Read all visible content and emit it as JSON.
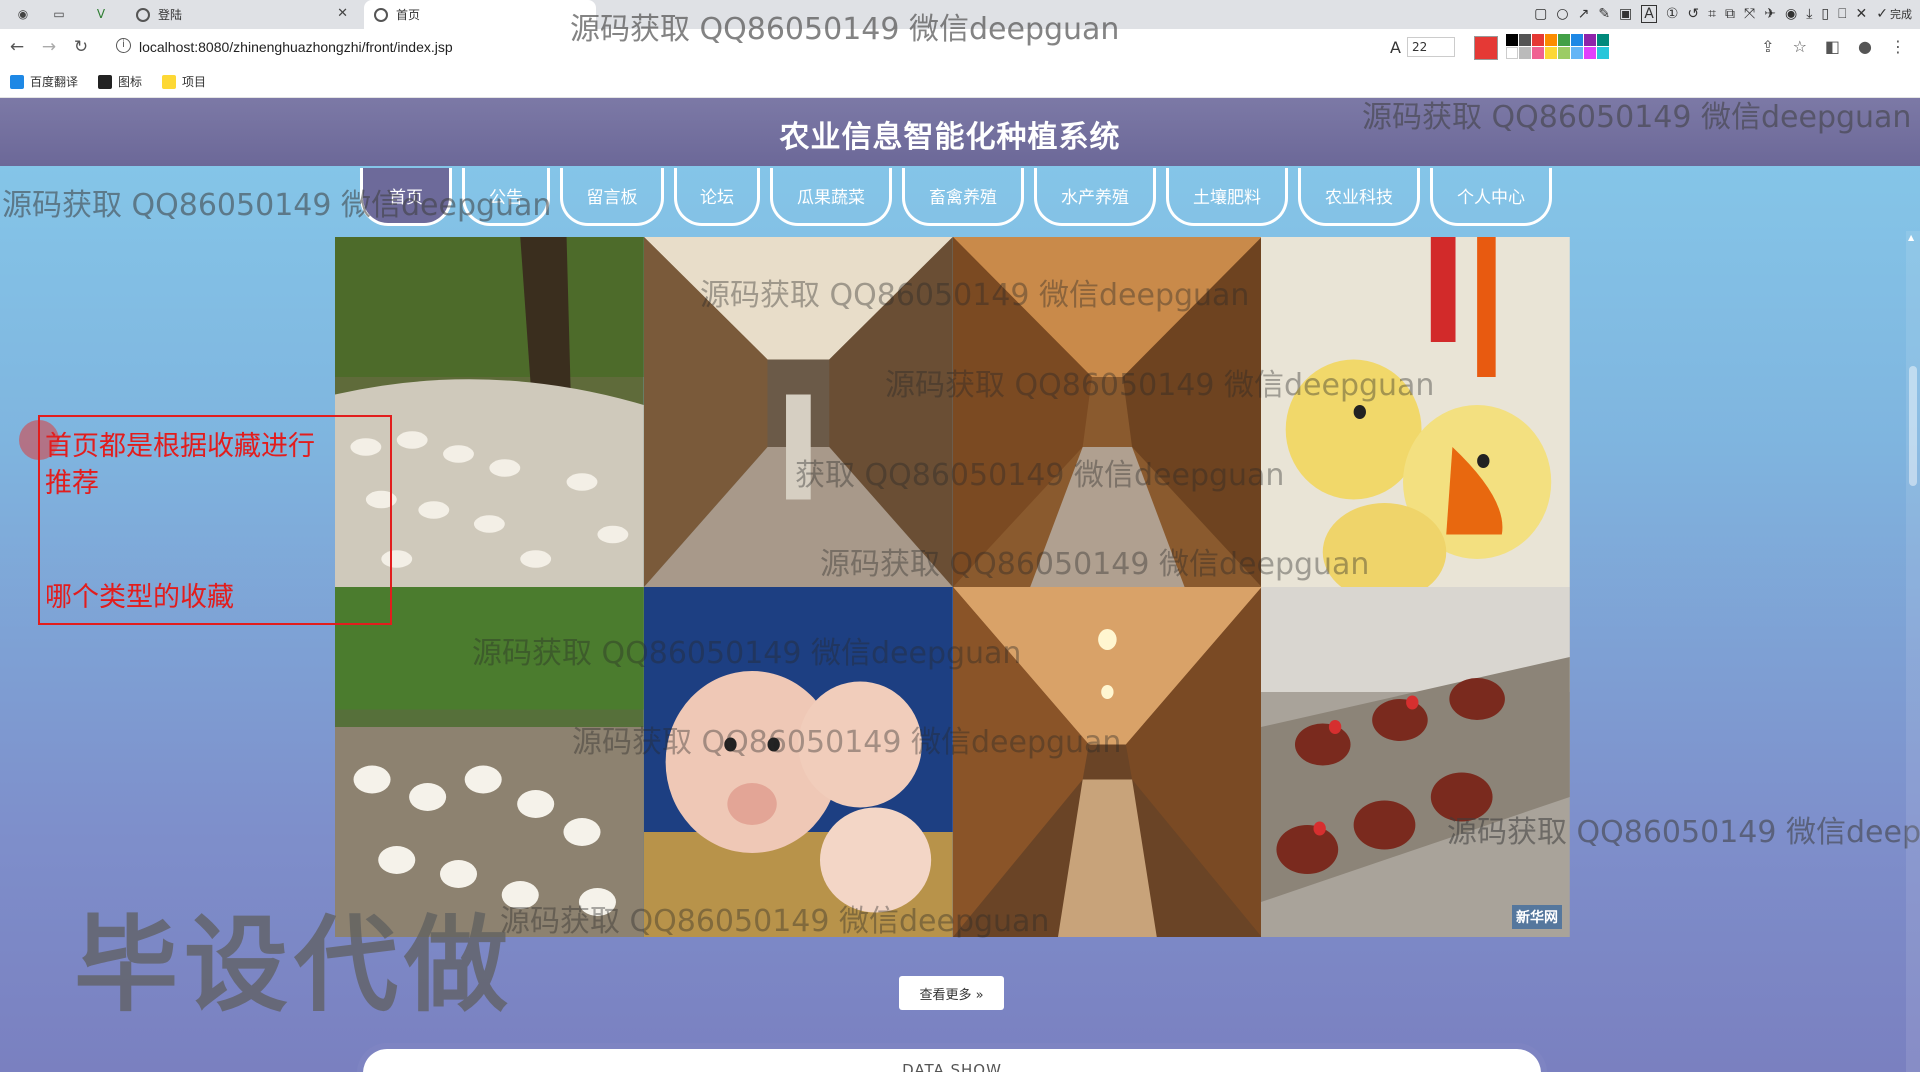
{
  "browser": {
    "tabs": [
      {
        "label": "登陆"
      },
      {
        "label": "首页"
      }
    ],
    "url": "localhost:8080/zhinenghuazhongzhi/front/index.jsp",
    "bookmarks": [
      "百度翻译",
      "图标",
      "项目"
    ],
    "annotation_toolbar": {
      "font_size": "22",
      "done_label": "完成",
      "current_color": "#e53935"
    }
  },
  "site": {
    "title": "农业信息智能化种植系统"
  },
  "menu": [
    {
      "label": "首页",
      "active": true
    },
    {
      "label": "公告",
      "active": false
    },
    {
      "label": "留言板",
      "active": false
    },
    {
      "label": "论坛",
      "active": false
    },
    {
      "label": "瓜果蔬菜",
      "active": false
    },
    {
      "label": "畜禽养殖",
      "active": false
    },
    {
      "label": "水产养殖",
      "active": false
    },
    {
      "label": "土壤肥料",
      "active": false
    },
    {
      "label": "农业科技",
      "active": false
    },
    {
      "label": "个人中心",
      "active": false
    }
  ],
  "gallery": {
    "images": [
      {
        "subject": "goose-flock"
      },
      {
        "subject": "poultry-cage-corridor"
      },
      {
        "subject": "layer-cage-aisle"
      },
      {
        "subject": "chicks-drinking"
      },
      {
        "subject": "white-chickens-farm"
      },
      {
        "subject": "piglets"
      },
      {
        "subject": "cage-aisle-lit"
      },
      {
        "subject": "hens-in-cages",
        "logo_text": "新华网"
      }
    ],
    "more_label": "查看更多 »"
  },
  "data_show": {
    "title": "DATA SHOW"
  },
  "annotation": {
    "line1": "首页都是根据收藏进行",
    "line2": "推荐",
    "line3": "哪个类型的收藏"
  },
  "watermark": {
    "text": "源码获取 QQ86050149 微信deepguan",
    "partial": "源码获取 QQ86050149 微信deep",
    "fragment1": "获取 QQ86050149 微信deepguan",
    "fragment2": "源码获取 QQ86050149 微信deepguan",
    "big": "毕设代做"
  }
}
